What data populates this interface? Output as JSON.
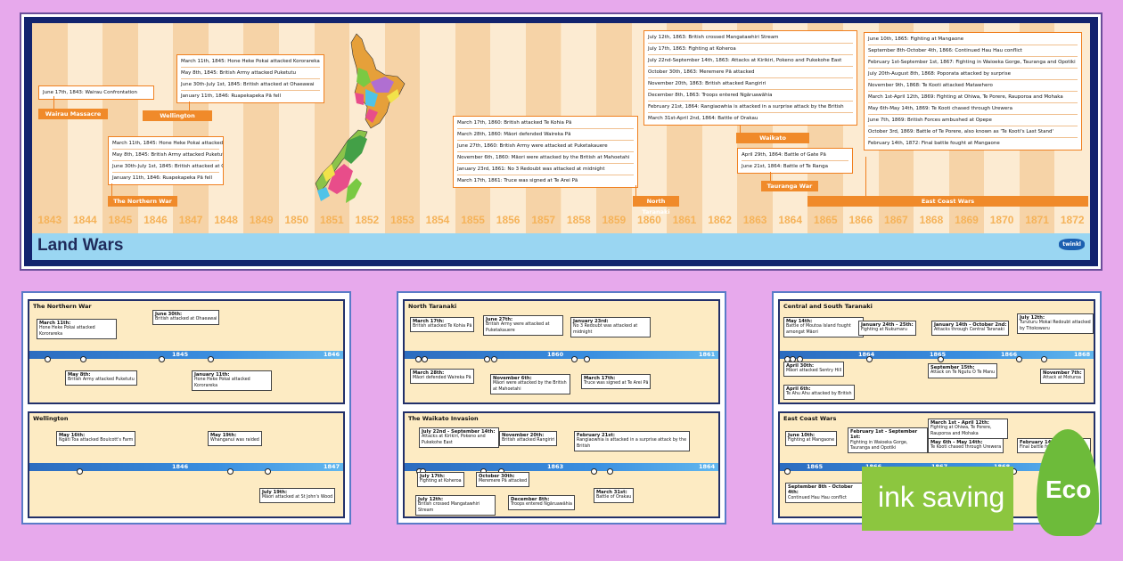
{
  "banner": {
    "title": "Land Wars",
    "logo": "twinkl"
  },
  "years": [
    "1843",
    "1844",
    "1845",
    "1846",
    "1847",
    "1848",
    "1849",
    "1850",
    "1851",
    "1852",
    "1853",
    "1854",
    "1855",
    "1856",
    "1857",
    "1858",
    "1859",
    "1860",
    "1861",
    "1862",
    "1863",
    "1864",
    "1865",
    "1866",
    "1867",
    "1868",
    "1869",
    "1870",
    "1871",
    "1872"
  ],
  "events": {
    "wairau": [
      "June 17th, 1843: Wairau Confrontation"
    ],
    "wellington": [
      "March 11th, 1845: Hone Heke Pokai attacked Kororareka",
      "May 8th, 1845: British Army attacked Puketutu",
      "June 30th-July 1st, 1845: British attacked at Ohaeawai",
      "January 11th, 1846: Ruapekapeka Pā fell"
    ],
    "northern": [
      "March 11th, 1845: Hone Heke Pokai attacked Kororareka",
      "May 8th, 1845: British Army attacked Puketutu",
      "June 30th-July 1st, 1845: British attacked at Ohaeawai",
      "January 11th, 1846: Ruapekapeka Pā fell"
    ],
    "taranaki": [
      "March 17th, 1860: British attacked Te Kohia Pā",
      "March 28th, 1860: Māori defended Waireka Pā",
      "June 27th, 1860: British Army were attacked at Puketakauere",
      "November 6th, 1860: Māori were attacked by the British at Mahoetahi",
      "January 23rd, 1861: No 3 Redoubt was attacked at midnight",
      "March 17th, 1861: Truce was signed at Te Arei Pā"
    ],
    "waikato": [
      "July 12th, 1863: British crossed Mangatawhiri Stream",
      "July 17th, 1863: Fighting at Koheroa",
      "July 22nd-September 14th, 1863: Attacks at Kirikiri, Pokeno and Pukekohe East",
      "October 30th, 1863: Meremere Pā attacked",
      "November 20th, 1863: British attacked Rangiriri",
      "December 8th, 1863: Troops entered Ngāruawāhia",
      "February 21st, 1864: Rangiaowhia is attacked in a surprise attack by the British",
      "March 31st-April 2nd, 1864: Battle of Orakau"
    ],
    "tauranga": [
      "April 29th, 1864: Battle of Gate Pā",
      "June 21st, 1864: Battle of Te Ranga"
    ],
    "eastcoast": [
      "June 10th, 1865: Fighting at Mangaone",
      "September 8th-October 4th, 1866: Continued Hau Hau conflict",
      "February 1st-September 1st, 1867: Fighting in Waioeka Gorge, Tauranga and Opotiki",
      "July 20th-August 8th, 1868: Poporata attacked by surprise",
      "November 9th, 1868: Te Kooti attacked Matawhero",
      "March 1st-April 12th, 1869: Fighting at Ohiwa, Te Porere, Rauporoa and Mohaka",
      "May 6th-May 14th, 1869: Te Kooti chased through Urewera",
      "June 7th, 1869: British Forces ambushed at Opepe",
      "October 3rd, 1869: Battle of Te Porere, also known as 'Te Kooti's Last Stand'",
      "February 14th, 1872: Final battle fought at Mangaone"
    ]
  },
  "tags": {
    "wairau": "Wairau Massacre",
    "wellington": "Wellington",
    "northern": "The Northern War",
    "taranaki": "North Taranaki",
    "waikato": "Waikato",
    "tauranga": "Tauranga War",
    "eastcoast": "East Coast Wars"
  },
  "panels": {
    "northern": {
      "title": "The Northern War",
      "years": [
        "1845",
        "1846"
      ],
      "labels": [
        {
          "d": "March 11th:",
          "t": "Hone Heke Pokai attacked Kororareka"
        },
        {
          "d": "May 8th:",
          "t": "British Army attacked Puketutu"
        },
        {
          "d": "June 30th:",
          "t": "British attacked at Ohaeawai"
        },
        {
          "d": "January 11th:",
          "t": "Hone Heke Pokai attacked Kororareka"
        }
      ]
    },
    "wellington": {
      "title": "Wellington",
      "years": [
        "1846",
        "1847"
      ],
      "labels": [
        {
          "d": "May 16th:",
          "t": "Ngāti Toa attacked Boulcott's Farm"
        },
        {
          "d": "May 19th:",
          "t": "Whanganui was raided"
        },
        {
          "d": "July 19th:",
          "t": "Māori attacked at St John's Wood"
        }
      ]
    },
    "taranaki": {
      "title": "North Taranaki",
      "years": [
        "1860",
        "1861"
      ],
      "labels": [
        {
          "d": "March 17th:",
          "t": "British attacked Te Kohia Pā"
        },
        {
          "d": "June 27th:",
          "t": "British Army were attacked at Puketakauere"
        },
        {
          "d": "January 23rd:",
          "t": "No 3 Redoubt was attacked at midnight"
        },
        {
          "d": "March 28th:",
          "t": "Māori defended Waireka Pā"
        },
        {
          "d": "November 6th:",
          "t": "Māori were attacked by the British at Mahoetahi"
        },
        {
          "d": "March 17th:",
          "t": "Truce was signed at Te Arei Pā"
        }
      ]
    },
    "waikato": {
      "title": "The Waikato Invasion",
      "years": [
        "1863",
        "1864"
      ],
      "labels": [
        {
          "d": "July 22nd - September 14th:",
          "t": "Attacks at Kirikiri, Pokeno and Pukekohe East"
        },
        {
          "d": "November 20th:",
          "t": "British attacked Rangiriri"
        },
        {
          "d": "February 21st:",
          "t": "Rangiaowhia is attacked in a surprise attack by the British"
        },
        {
          "d": "July 17th:",
          "t": "Fighting at Koheroa"
        },
        {
          "d": "October 30th:",
          "t": "Meremere Pā attacked"
        },
        {
          "d": "July 12th:",
          "t": "British crossed Mangatawhiri Stream"
        },
        {
          "d": "December 8th:",
          "t": "Troops entered Ngāruawāhia"
        },
        {
          "d": "March 31st:",
          "t": "Battle of Orakau"
        }
      ]
    },
    "central": {
      "title": "Central and South Taranaki",
      "years": [
        "1864",
        "1865",
        "1866",
        "1868"
      ],
      "labels": [
        {
          "d": "May 14th:",
          "t": "Battle of Moutoa Island fought amongst Māori"
        },
        {
          "d": "January 24th - 25th:",
          "t": "Fighting at Nukumaru"
        },
        {
          "d": "January 14th - October 2nd:",
          "t": "Attacks through Central Taranaki"
        },
        {
          "d": "July 12th:",
          "t": "Turuturu Mokai Redoubt attacked by Titokowaru"
        },
        {
          "d": "April 30th:",
          "t": "Māori attacked Sentry Hill"
        },
        {
          "d": "September 15th:",
          "t": "Attack on Te Ngutu O Te Manu"
        },
        {
          "d": "November 7th:",
          "t": "Attack at Moturoa"
        },
        {
          "d": "April 6th:",
          "t": "Te Ahu Ahu attacked by British"
        }
      ]
    },
    "eastcoast": {
      "title": "East Coast Wars",
      "years": [
        "1865",
        "1866",
        "1867",
        "1868",
        "1869",
        "1872"
      ],
      "labels": [
        {
          "d": "June 10th:",
          "t": "Fighting at Mangaone"
        },
        {
          "d": "February 1st - September 1st:",
          "t": "Fighting in Waioeka Gorge, Tauranga and Opotiki"
        },
        {
          "d": "March 1st - April 12th:",
          "t": "Fighting at Ohiwa, Te Porere, Rauporoa and Mohaka"
        },
        {
          "d": "May 6th - May 14th:",
          "t": "Te Kooti chased through Urewera"
        },
        {
          "d": "February 14th:",
          "t": "Final battle fought at Mangaone"
        },
        {
          "d": "September 8th - October 4th:",
          "t": "Continued Hau Hau conflict"
        }
      ]
    }
  },
  "badge": {
    "text": "ink saving",
    "eco": "Eco"
  },
  "colors": {
    "background": "#e7a9ec",
    "banner": "#12236e",
    "accent": "#f08a2a",
    "timeline": "#3a8fe0",
    "eco_green": "#6dbb3a"
  }
}
